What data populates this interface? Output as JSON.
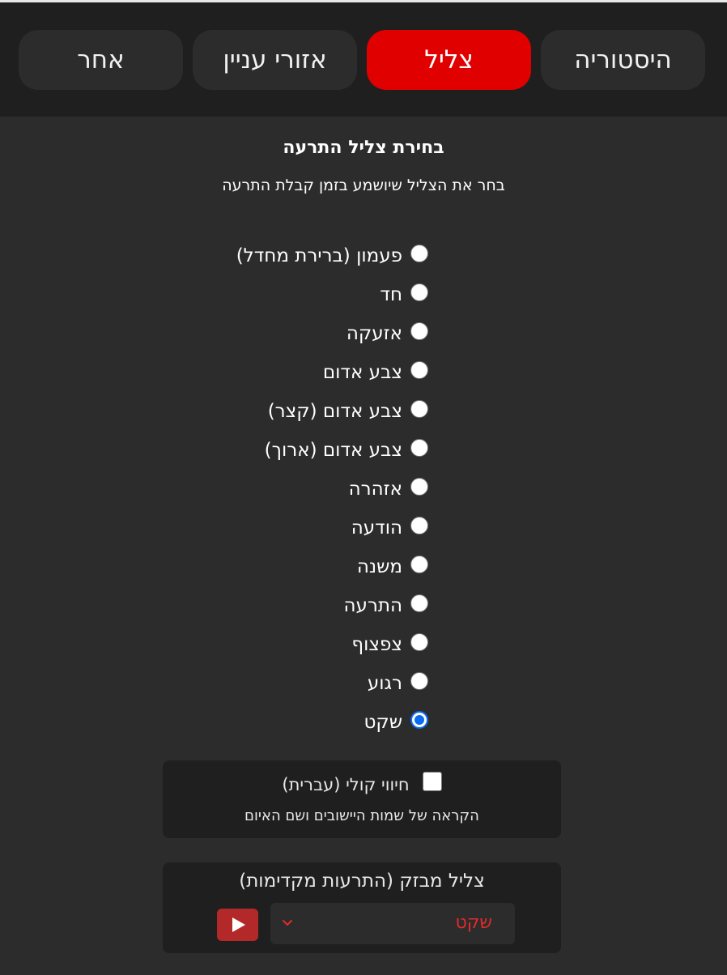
{
  "tabs": [
    {
      "label": "היסטוריה",
      "active": false
    },
    {
      "label": "צליל",
      "active": true
    },
    {
      "label": "אזורי עניין",
      "active": false
    },
    {
      "label": "אחר",
      "active": false
    }
  ],
  "section": {
    "title": "בחירת צליל התרעה",
    "subtitle": "בחר את הצליל שיושמע בזמן קבלת התרעה"
  },
  "sounds": [
    {
      "label": "פעמון (ברירת מחדל)",
      "checked": false
    },
    {
      "label": "חד",
      "checked": false
    },
    {
      "label": "אזעקה",
      "checked": false
    },
    {
      "label": "צבע אדום",
      "checked": false
    },
    {
      "label": "צבע אדום (קצר)",
      "checked": false
    },
    {
      "label": "צבע אדום (ארוך)",
      "checked": false
    },
    {
      "label": "אזהרה",
      "checked": false
    },
    {
      "label": "הודעה",
      "checked": false
    },
    {
      "label": "משנה",
      "checked": false
    },
    {
      "label": "התרעה",
      "checked": false
    },
    {
      "label": "צפצוף",
      "checked": false
    },
    {
      "label": "רגוע",
      "checked": false
    },
    {
      "label": "שקט",
      "checked": true
    }
  ],
  "voice": {
    "label": "חיווי קולי (עברית)",
    "description": "הקראה של שמות היישובים ושם האיום",
    "checked": false
  },
  "preview": {
    "title": "צליל מבזק (התרעות מקדימות)",
    "selected_value": "שקט",
    "play_icon": "play-icon",
    "arrow_icon": "chevron-down-icon"
  },
  "colors": {
    "accent": "#e00000",
    "radio_checked": "#0b6cf0",
    "select_text": "#e32a2a"
  }
}
